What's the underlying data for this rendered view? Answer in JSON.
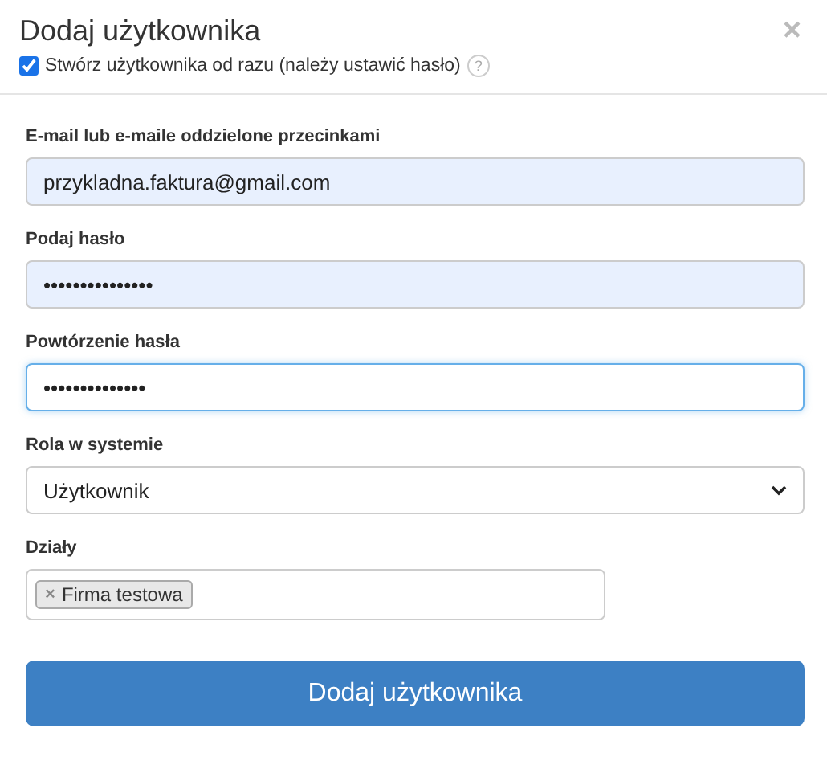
{
  "dialog": {
    "title": "Dodaj użytkownika",
    "close": "×"
  },
  "create_now": {
    "label": "Stwórz użytkownika od razu (należy ustawić hasło)",
    "checked": true,
    "help": "?"
  },
  "fields": [
    {
      "kind": "text",
      "label": "E-mail lub e-maile oddzielone przecinkami",
      "value": "przykladna.faktura@gmail.com",
      "autofilled": true,
      "focused": false
    },
    {
      "kind": "text",
      "label": "Podaj hasło",
      "value": "•••••••••••••••",
      "autofilled": true,
      "focused": false
    },
    {
      "kind": "text",
      "label": "Powtórzenie hasła",
      "value": "••••••••••••••",
      "autofilled": false,
      "focused": true
    },
    {
      "kind": "select",
      "label": "Rola w systemie",
      "value": "Użytkownik",
      "autofilled": false,
      "focused": false
    },
    {
      "kind": "tags",
      "label": "Działy",
      "tags": [
        {
          "remove": "×",
          "label": "Firma testowa"
        }
      ],
      "autofilled": false,
      "focused": false
    }
  ],
  "submit": "Dodaj użytkownika"
}
